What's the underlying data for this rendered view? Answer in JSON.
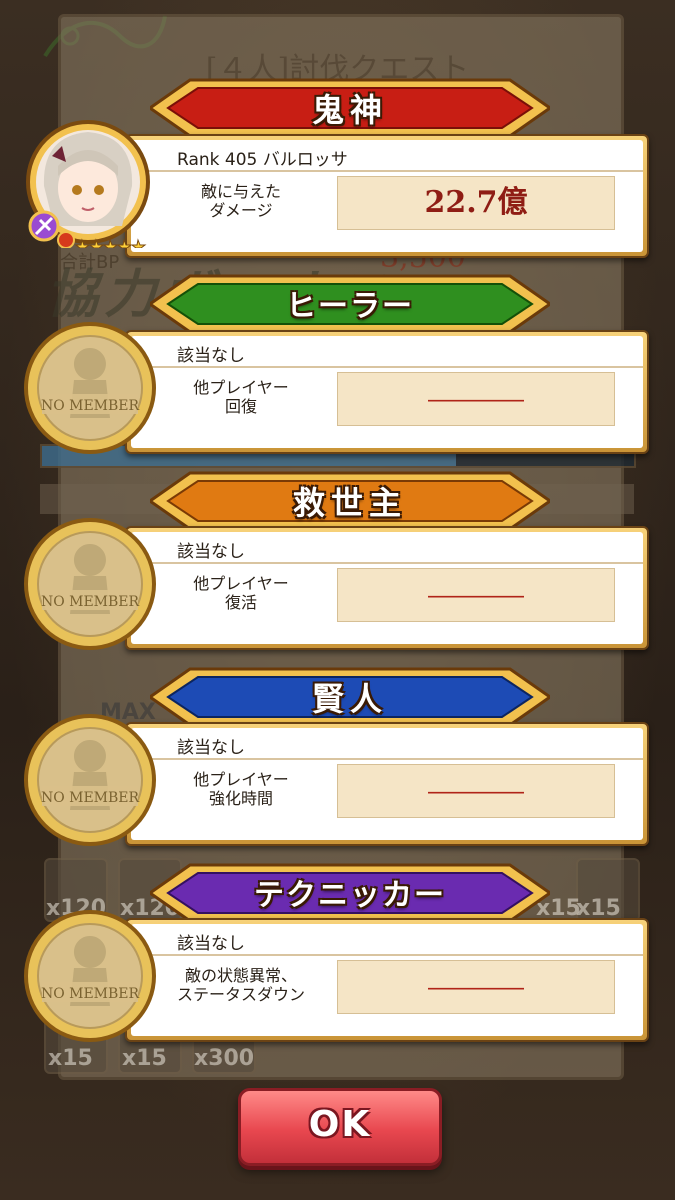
{
  "background": {
    "quest_title": "[４人]討伐クエスト",
    "bp_label": "合計BP",
    "bp_value": "3,500",
    "bonus_text": "協力ボーナス",
    "max_label": "MAX",
    "item_counts": [
      "x120",
      "x120",
      "x15",
      "x15",
      "x15",
      "x15",
      "x300"
    ]
  },
  "awards": [
    {
      "title": "鬼神",
      "banner_color": "red",
      "player": "Rank  405   バルロッサ",
      "stat_label": "敵に与えた\nダメージ",
      "value": "22.7億",
      "avatar": "player-portrait"
    },
    {
      "title": "ヒーラー",
      "banner_color": "green",
      "player": "該当なし",
      "stat_label": "他プレイヤー\n回復",
      "value": "――――",
      "avatar": "no-member-medal"
    },
    {
      "title": "救世主",
      "banner_color": "orange",
      "player": "該当なし",
      "stat_label": "他プレイヤー\n復活",
      "value": "――――",
      "avatar": "no-member-medal"
    },
    {
      "title": "賢人",
      "banner_color": "blue",
      "player": "該当なし",
      "stat_label": "他プレイヤー\n強化時間",
      "value": "――――",
      "avatar": "no-member-medal"
    },
    {
      "title": "テクニッカー",
      "banner_color": "purple",
      "player": "該当なし",
      "stat_label": "敵の状態異常、\nステータスダウン",
      "value": "――――",
      "avatar": "no-member-medal"
    }
  ],
  "medal_text": "NO MEMBER",
  "player_stars": 5,
  "ok_label": "OK",
  "colors": {
    "red": "#c81e14",
    "green": "#2f8f1f",
    "orange": "#e07a12",
    "blue": "#1d4bb5",
    "purple": "#6a2bb0",
    "gold": "#f2c14e",
    "ok_button": "#e8474f"
  }
}
